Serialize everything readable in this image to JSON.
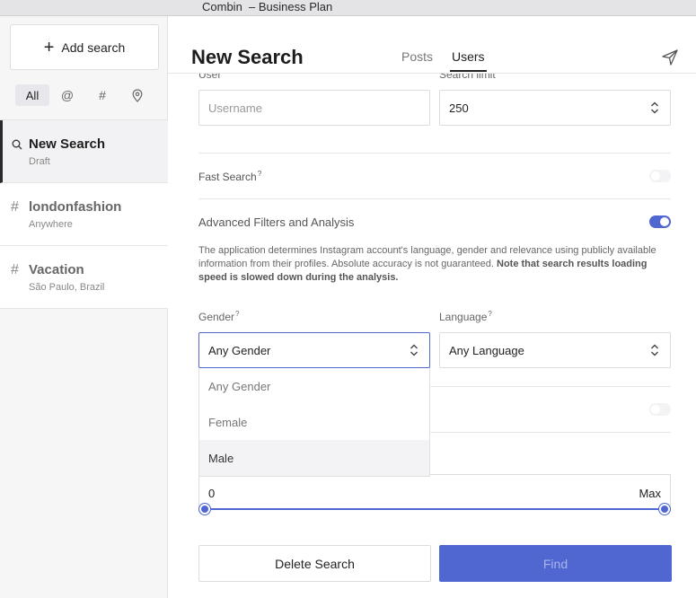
{
  "window": {
    "title": "Combin  – Business Plan"
  },
  "sidebar": {
    "add_search_label": "Add search",
    "filters": [
      {
        "label": "All",
        "icon": "all"
      },
      {
        "label": "@",
        "icon": "at-icon"
      },
      {
        "label": "#",
        "icon": "hashtag-icon"
      },
      {
        "label": "",
        "icon": "location-pin-icon"
      }
    ],
    "items": [
      {
        "icon": "search-icon",
        "name": "New Search",
        "sub": "Draft"
      },
      {
        "icon": "hashtag-icon",
        "name": "londonfashion",
        "sub": "Anywhere"
      },
      {
        "icon": "hashtag-icon",
        "name": "Vacation",
        "sub": "São Paulo, Brazil"
      }
    ]
  },
  "header": {
    "title": "New Search",
    "tabs": [
      {
        "label": "Posts"
      },
      {
        "label": "Users"
      }
    ],
    "active_tab": "Users"
  },
  "form": {
    "user_label": "User",
    "username_placeholder": "Username",
    "search_limit_label": "Search limit",
    "search_limit_value": "250",
    "fast_search_label": "Fast Search",
    "fast_search_on": false,
    "advanced_label": "Advanced Filters and Analysis",
    "advanced_on": true,
    "description_text": "The application determines Instagram account's language, gender and relevance using publicly available information from their profiles. Absolute accuracy is not guaranteed. ",
    "description_bold": "Note that search results loading speed is slowed down during the analysis.",
    "gender_label": "Gender",
    "gender_value": "Any Gender",
    "gender_options": [
      "Any Gender",
      "Female",
      "Male"
    ],
    "gender_highlighted": "Male",
    "language_label": "Language",
    "language_value": "Any Language",
    "hidden_toggle_on": false,
    "range_min": "0",
    "range_max": "Max",
    "tooltip_mark": "?"
  },
  "actions": {
    "delete_label": "Delete Search",
    "find_label": "Find"
  },
  "colors": {
    "accent": "#5066d0",
    "find_text": "#aab5ea"
  }
}
